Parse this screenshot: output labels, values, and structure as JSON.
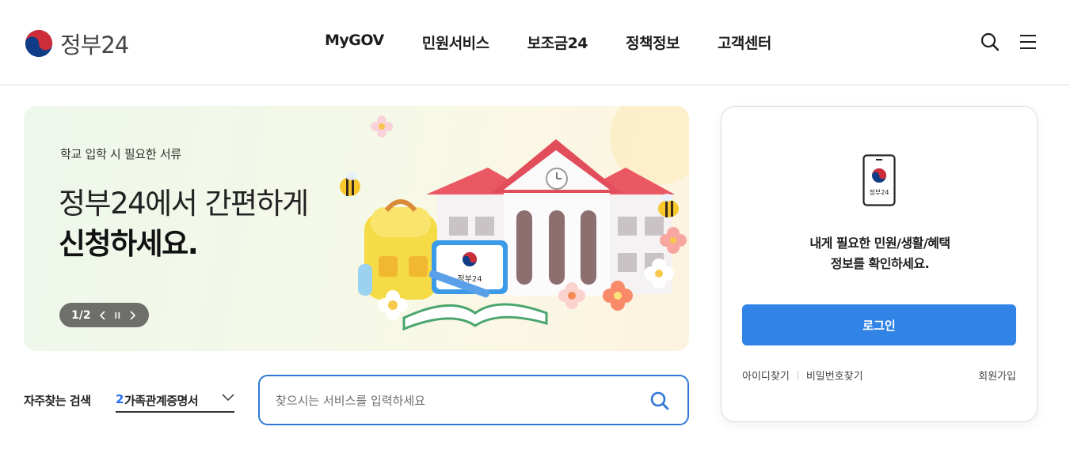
{
  "brand": {
    "name": "정부24"
  },
  "nav": {
    "items": [
      "MyGOV",
      "민원서비스",
      "보조금24",
      "정책정보",
      "고객센터"
    ]
  },
  "banner": {
    "subtitle": "학교 입학 시 필요한 서류",
    "title_line1": "정부24에서 간편하게",
    "title_line2": "신청하세요.",
    "pager": "1/2",
    "tablet_label": "정부24"
  },
  "frequent": {
    "label": "자주찾는 검색",
    "rank": "2",
    "value": "가족관계증명서"
  },
  "search": {
    "placeholder": "찾으시는 서비스를 입력하세요"
  },
  "login": {
    "phone_label": "정부24",
    "message_line1": "내게 필요한 민원/생활/혜택",
    "message_line2": "정보를 확인하세요.",
    "button": "로그인",
    "find_id": "아이디찾기",
    "find_pw": "비밀번호찾기",
    "signup": "회원가입"
  },
  "icons": [
    "taegeuk-emblem-icon",
    "search-icon",
    "hamburger-menu-icon",
    "prev-icon",
    "pause-icon",
    "next-icon",
    "chevron-down-icon",
    "mobile-phone-icon"
  ],
  "colors": {
    "accent": "#3183e5",
    "search_border": "#2f78d6",
    "rank": "#256ef4",
    "emblem_red": "#cd2e3a",
    "emblem_blue": "#0f3c87"
  }
}
